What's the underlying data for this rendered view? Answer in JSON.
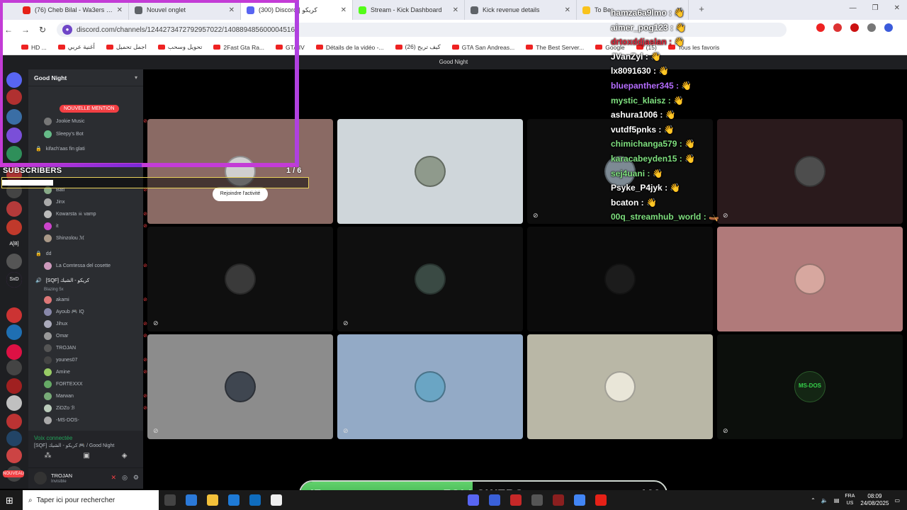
{
  "browser": {
    "tabs": [
      {
        "title": "(76) Cheb Bilal - Wa3ers Da3wati",
        "color": "#e62117",
        "active": false
      },
      {
        "title": "Nouvel onglet",
        "color": "#5f6368",
        "active": false
      },
      {
        "title": "(300) Discord | كريكو",
        "color": "#5865f2",
        "active": true
      },
      {
        "title": "Stream - Kick Dashboard",
        "color": "#53fc18",
        "active": false
      },
      {
        "title": "Kick revenue details",
        "color": "#5f6368",
        "active": false
      },
      {
        "title": "To Be",
        "color": "#f9c31d",
        "active": false
      }
    ],
    "url": "discord.com/channels/1244273472792957022/1408894856000045166",
    "bookmarks": [
      "HD ...",
      "أغنية عربي",
      "اجمل تحميل",
      "تحويل وسحب",
      "2Fast Gta Ra...",
      "GTA IV",
      "Détails de la vidéo -...",
      "(26) كيف تربح",
      "GTA San Andreas...",
      "The Best Server...",
      "Google",
      "(15)",
      "Tous les favoris"
    ],
    "window_controls": [
      "—",
      "❐",
      "✕"
    ]
  },
  "discord": {
    "window_title": "Good Night",
    "server_name": "Good Night",
    "new_mention_badge": "NOUVELLE MENTION",
    "guild_labels": [
      "A[B]",
      "SxD",
      "NOUVEAU"
    ],
    "channels": [
      {
        "label": "Jookie Music",
        "type": "user"
      },
      {
        "label": "Sleepy's Bot",
        "type": "user"
      },
      {
        "label": "kifach'aas fin glati",
        "type": "lock"
      },
      {
        "label": "Bati",
        "type": "user"
      },
      {
        "label": "Jinx",
        "type": "user"
      },
      {
        "label": "Kowarsta ☠ vamp",
        "type": "user"
      },
      {
        "label": "it",
        "type": "user"
      },
      {
        "label": "Shinzolou ℳ",
        "type": "user"
      },
      {
        "label": "dd",
        "type": "lock"
      },
      {
        "label": "La Comtessa del cosette",
        "type": "user"
      },
      {
        "label": "[SQF] كريكو - الشيك",
        "type": "voice"
      },
      {
        "label": "Blazing 5x",
        "type": "sub"
      },
      {
        "label": "akami",
        "type": "user"
      },
      {
        "label": "Ayoub 🎮 IQ",
        "type": "user"
      },
      {
        "label": "Jihux",
        "type": "user"
      },
      {
        "label": "Omar",
        "type": "user"
      },
      {
        "label": "TROJAN",
        "type": "user"
      },
      {
        "label": "younes07",
        "type": "user"
      },
      {
        "label": "Amine",
        "type": "user"
      },
      {
        "label": "FORTEXXX",
        "type": "user"
      },
      {
        "label": "Marwan",
        "type": "user"
      },
      {
        "label": "ZiDZo ℬ",
        "type": "user"
      },
      {
        "label": "-MS-DOS-",
        "type": "user"
      }
    ],
    "voice_status": "Voix connectée",
    "voice_channel": "[SQF] كريكو - الشيك 🎮 / Good Night",
    "user": {
      "name": "TROJAN",
      "status": "Invisible"
    },
    "join_activity": "Rejoindre l'activité",
    "tiles": [
      {
        "bg": "#8a6a64",
        "avatar": "#cfcfcf",
        "mute": false
      },
      {
        "bg": "#cfd6da",
        "avatar": "#8f9a8c",
        "mute": false
      },
      {
        "bg": "#0d0d0d",
        "avatar": "#7d8a94",
        "mute": true
      },
      {
        "bg": "#2a1a1c",
        "avatar": "#4d4d4d",
        "mute": true
      },
      {
        "bg": "#0f0f0f",
        "avatar": "#3a3a3a",
        "mute": true
      },
      {
        "bg": "#0f0f0f",
        "avatar": "#3a4a44",
        "mute": true
      },
      {
        "bg": "#0b0b0b",
        "avatar": "#1c1c1c",
        "mute": false
      },
      {
        "bg": "#b07a7a",
        "avatar": "#d7a79f",
        "mute": false
      },
      {
        "bg": "#8c8c8c",
        "avatar": "#3f4650",
        "mute": true
      },
      {
        "bg": "#93aac6",
        "avatar": "#6aa5c4",
        "mute": true
      },
      {
        "bg": "#b9b7a6",
        "avatar": "#e9e6d8",
        "mute": false
      },
      {
        "bg": "#0c0f0c",
        "avatar": "#142614",
        "mute": true,
        "text": "MS-DOS"
      }
    ]
  },
  "overlay": {
    "subscribers_label": "SUBSCRIBERS",
    "subscribers_count": "1 / 6",
    "subscribers_progress": 0.167,
    "chat": [
      {
        "text": "hamza6a9lmo : 👋",
        "color": "#ffffff"
      },
      {
        "text": "aimer_pog123 : 👋",
        "color": "#ffffff"
      },
      {
        "text": "drtoxddjaslan : 👋",
        "color": "#e0263a"
      },
      {
        "text": "JVanZyl : 👋",
        "color": "#ffffff"
      },
      {
        "text": "lx8091630 : 👋",
        "color": "#ffffff"
      },
      {
        "text": "bluepanther345 : 👋",
        "color": "#b56cff"
      },
      {
        "text": "mystic_klaisz : 👋",
        "color": "#7fe07f"
      },
      {
        "text": "ashura1006 : 👋",
        "color": "#ffffff"
      },
      {
        "text": "vutdf5pnks : 👋",
        "color": "#ffffff"
      },
      {
        "text": "chimichanga579 : 👋",
        "color": "#7fe07f"
      },
      {
        "text": "karacabeyden15 : 👋",
        "color": "#7fe07f"
      },
      {
        "text": "sej4uani : 👋",
        "color": "#7fe07f"
      },
      {
        "text": "Psyke_P4jyk : 👋",
        "color": "#ffffff"
      },
      {
        "text": "bcaton : 👋",
        "color": "#ffffff"
      },
      {
        "text": "00q_streamhub_world : 🛶",
        "color": "#7fe07f"
      }
    ],
    "followers": {
      "label": "FOLLOWERS",
      "current": "47",
      "goal": "100",
      "progress": 0.47
    }
  },
  "taskbar": {
    "search_placeholder": "Taper ici pour rechercher",
    "lang": "FRA",
    "region": "US",
    "time": "08:09",
    "date": "24/08/2025"
  }
}
